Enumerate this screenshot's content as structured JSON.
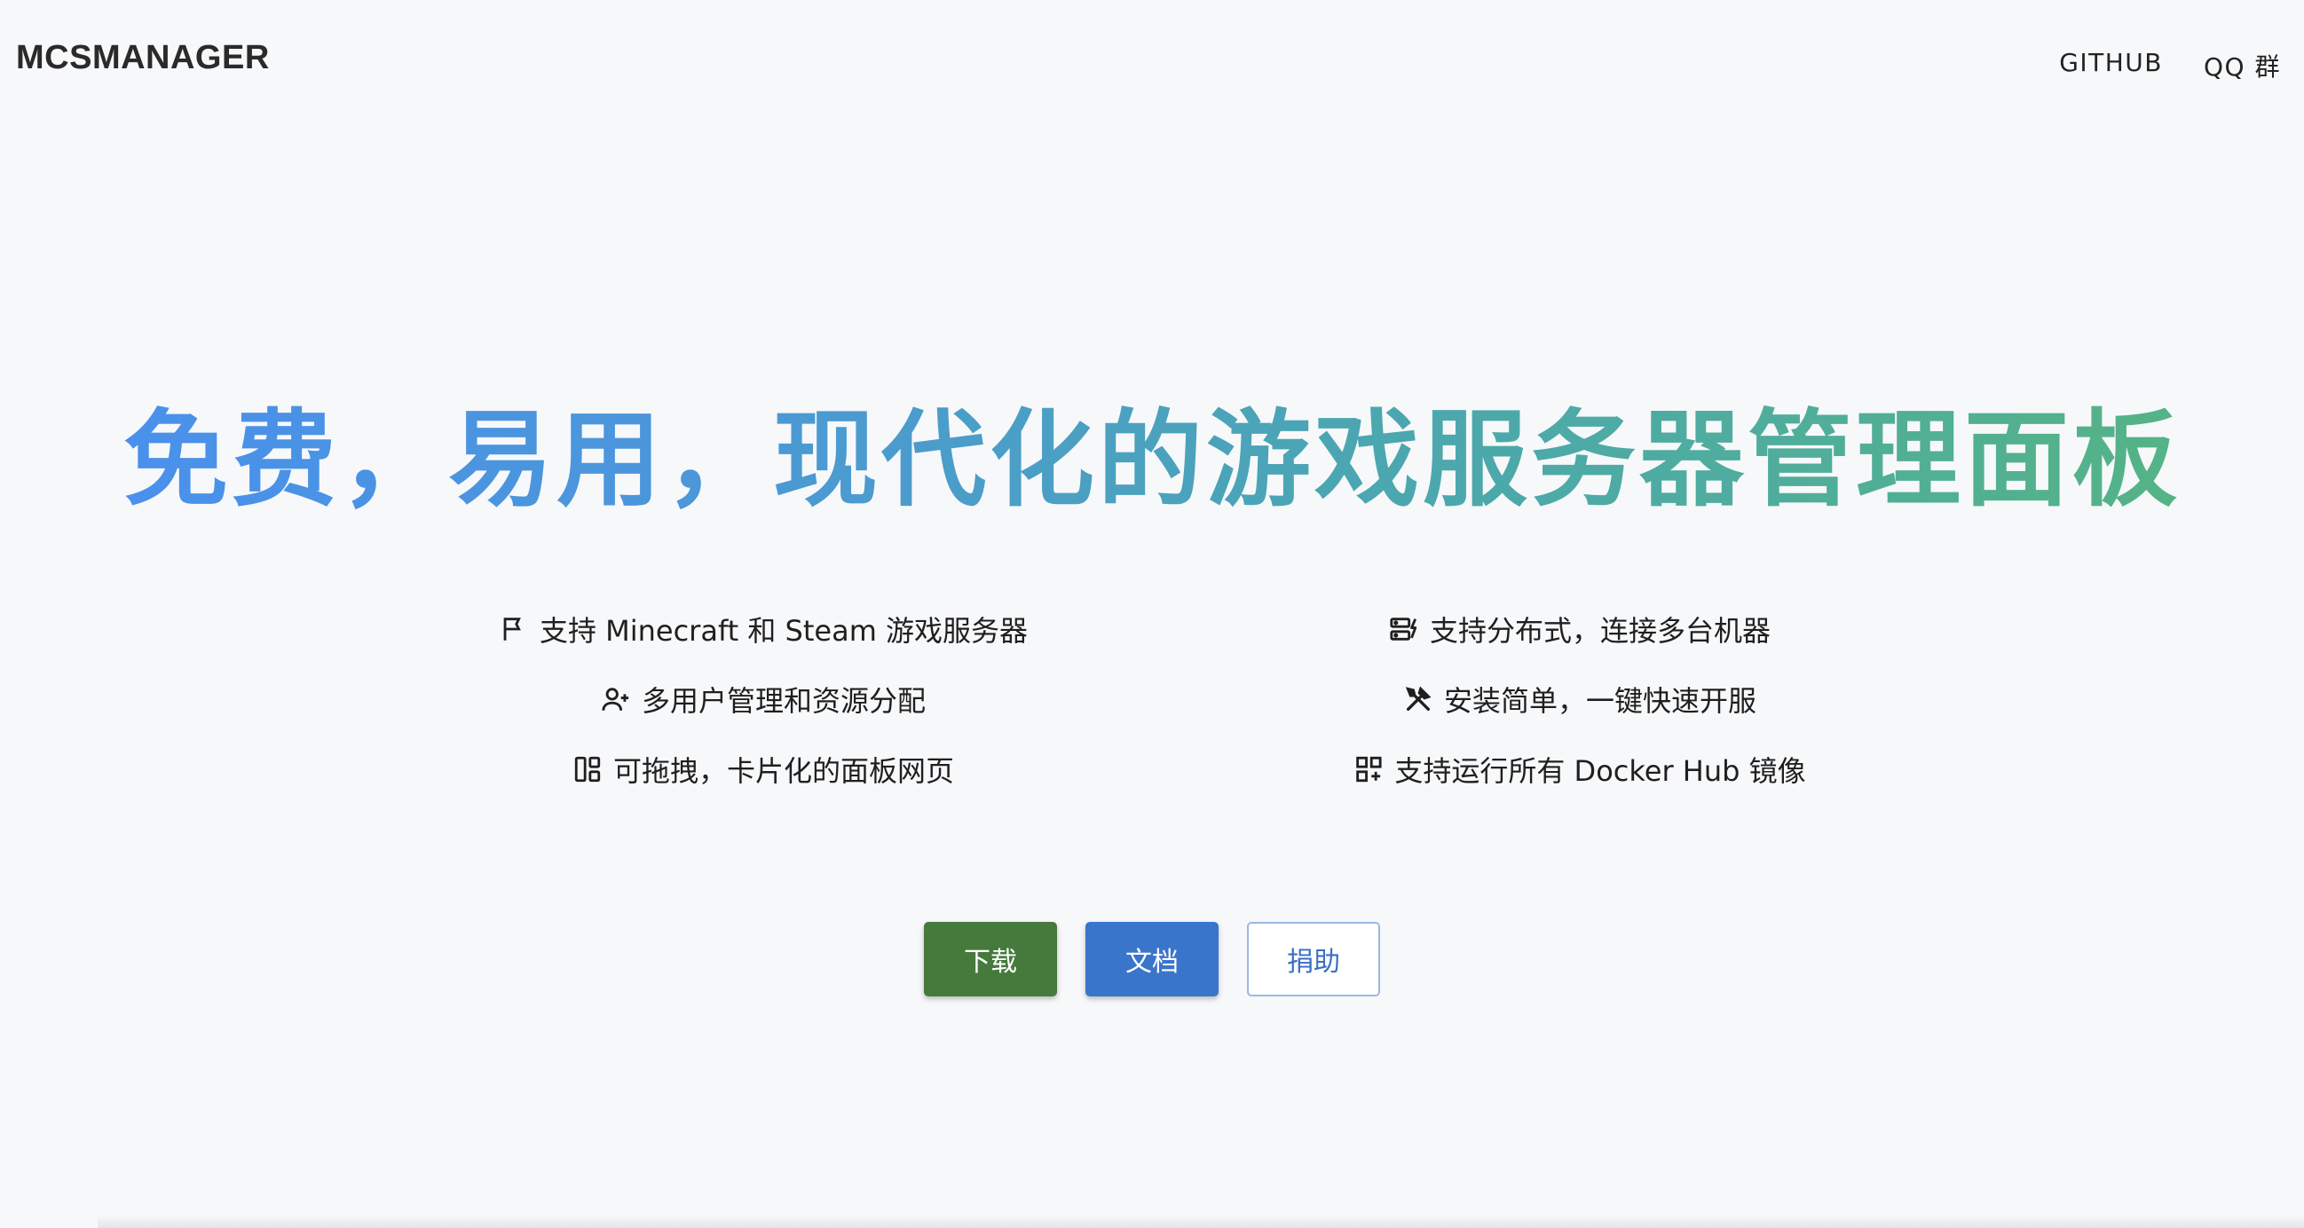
{
  "header": {
    "brand": "MCSMANAGER",
    "nav": [
      {
        "label": "GITHUB"
      },
      {
        "label": "QQ 群"
      }
    ]
  },
  "hero": {
    "title": "免费，易用，现代化的游戏服务器管理面板",
    "gradient_colors": [
      "#4a8ff0",
      "#4ba7b0",
      "#56b580"
    ]
  },
  "features": [
    {
      "icon": "flag-icon",
      "text": "支持 Minecraft 和 Steam 游戏服务器"
    },
    {
      "icon": "server-nodes-icon",
      "text": "支持分布式，连接多台机器"
    },
    {
      "icon": "add-user-icon",
      "text": "多用户管理和资源分配"
    },
    {
      "icon": "tools-icon",
      "text": "安装简单，一键快速开服"
    },
    {
      "icon": "dashboard-icon",
      "text": "可拖拽，卡片化的面板网页"
    },
    {
      "icon": "qr-grid-icon",
      "text": "支持运行所有 Docker Hub 镜像"
    }
  ],
  "buttons": {
    "download": "下载",
    "docs": "文档",
    "donate": "捐助"
  },
  "colors": {
    "download": "#467a3c",
    "docs": "#3a75cc",
    "donate_text": "#3a6ec4",
    "background": "#f7f8fa"
  }
}
